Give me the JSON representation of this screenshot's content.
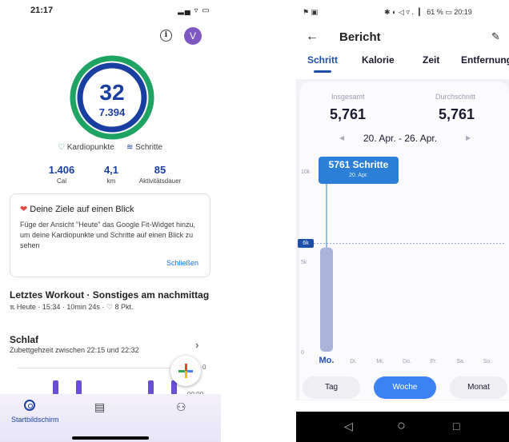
{
  "left": {
    "status_time": "21:17",
    "status_icons": "▂▄ ▿ ▭",
    "info_icon": "i",
    "avatar_letter": "V",
    "ring_main": "32",
    "ring_sub": "7.394",
    "legend_heart": "Kardiopunkte",
    "legend_steps": "Schritte",
    "stats": [
      {
        "value": "1.406",
        "label": "Cal"
      },
      {
        "value": "4,1",
        "label": "km"
      },
      {
        "value": "85",
        "label": "Aktivitätsdauer"
      }
    ],
    "card": {
      "title": "Deine Ziele auf einen Blick",
      "body": "Füge der Ansicht \"Heute\" das Google Fit-Widget hinzu, um deine Kardiopunkte und Schritte auf einen Blick zu sehen",
      "link": "Schließen"
    },
    "workout": {
      "title": "Letztes Workout · Sonstiges am nachmittag",
      "subtitle": "Heute · 15:34 · 10min 24s · ♡ 8 Pkt."
    },
    "sleep": {
      "title": "Schlaf",
      "subtitle": "Zubettgehzeit zwischen 22:15 und 22:32",
      "tick_top": "0",
      "tick_bottom": "00:00"
    },
    "nav": {
      "home_label": "Startbildschirm"
    },
    "colors": {
      "ring_outer": "#1ea362",
      "ring_inner": "#1a3fa3",
      "avatar": "#7e57c2",
      "link": "#1a73e8"
    }
  },
  "right": {
    "status_left": "⚑ ▣",
    "status_right": "✱ ◐ ◁ ▿ .▕▏ 61 % ▭ 20:19",
    "title": "Bericht",
    "tabs": [
      "Schritt",
      "Kalorie",
      "Zeit",
      "Entfernung"
    ],
    "active_tab": "Schritt",
    "total_label": "Insgesamt",
    "total_value": "5,761",
    "avg_label": "Durchschnitt",
    "avg_value": "5,761",
    "date_range": "20. Apr. - 26. Apr.",
    "tooltip_value": "5761 Schritte",
    "tooltip_date": "20. Apr.",
    "goal_badge": "6k",
    "buttons": [
      "Tag",
      "Woche",
      "Monat"
    ],
    "active_button": "Woche",
    "colors": {
      "accent": "#1e4fa8",
      "bar": "#aab4d8",
      "tooltip": "#2b7fd6",
      "button_active": "#3b82f6"
    }
  },
  "chart_data": {
    "type": "bar",
    "categories": [
      "Mo.",
      "Di.",
      "Mi.",
      "Do.",
      "Fr.",
      "Sa.",
      "So."
    ],
    "values": [
      5761,
      0,
      0,
      0,
      0,
      0,
      0
    ],
    "y_ticks": [
      "0",
      "5k",
      "10k"
    ],
    "ylim": [
      0,
      10000
    ],
    "goal_line": 6000,
    "grid": false
  }
}
